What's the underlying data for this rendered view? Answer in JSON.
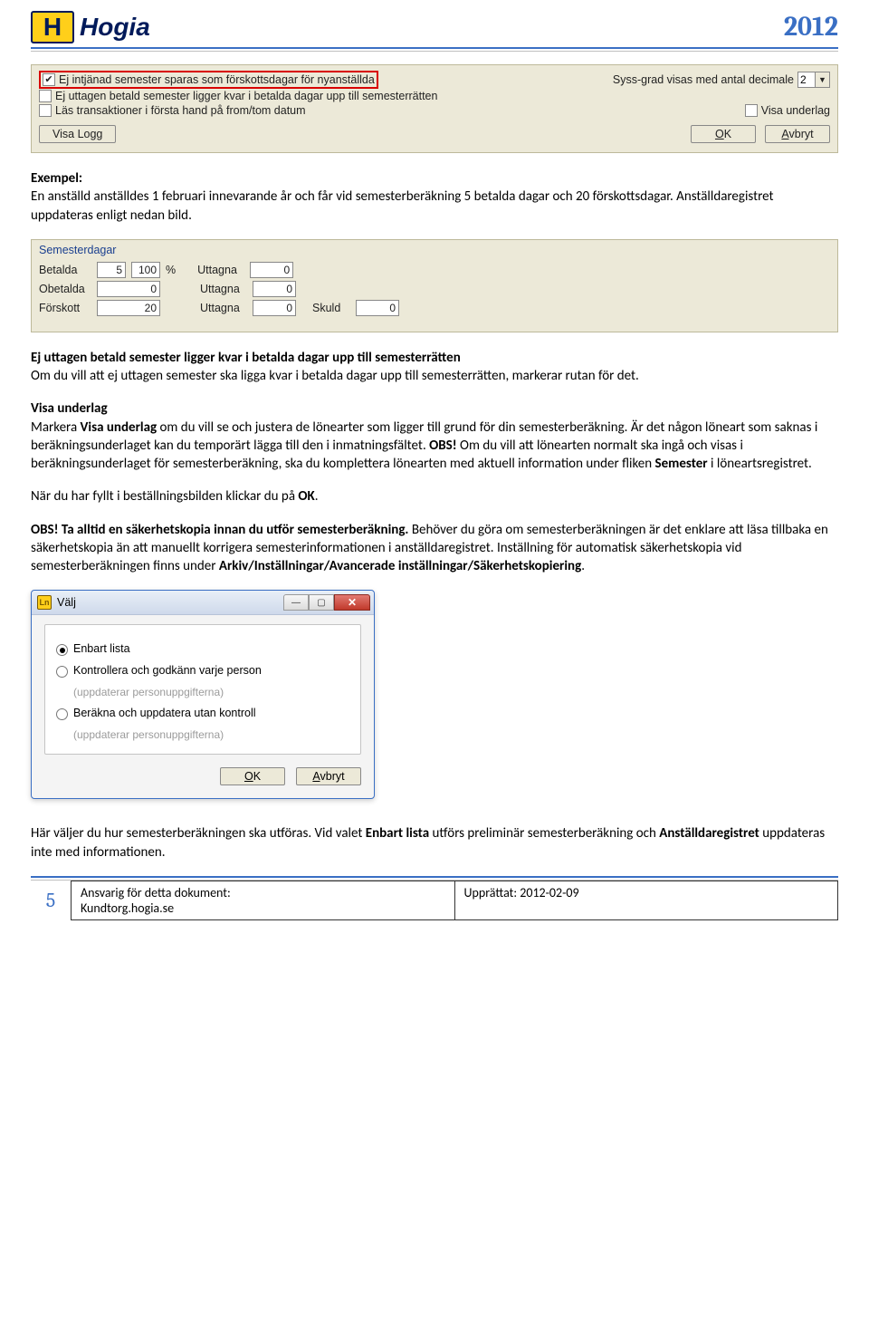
{
  "header": {
    "logo_letter": "H",
    "logo_text": "Hogia",
    "year": "2012"
  },
  "panel1": {
    "cb1": "Ej intjänad semester sparas som förskottsdagar för nyanställda",
    "cb2": "Ej uttagen betald semester ligger kvar i betalda dagar upp till semesterrätten",
    "cb3": "Läs transaktioner i första hand på from/tom datum",
    "syss_label": "Syss-grad visas med antal decimale",
    "syss_value": "2",
    "cb4": "Visa underlag",
    "btn_logg": "Visa Logg",
    "btn_ok_u": "O",
    "btn_ok_rest": "K",
    "btn_cancel_u": "A",
    "btn_cancel_rest": "vbryt"
  },
  "text1": {
    "ex_head": "Exempel:",
    "ex_body": "En anställd anställdes 1 februari innevarande år och får vid semesterberäkning 5 betalda dagar och 20 förskottsdagar. Anställdaregistret uppdateras enligt nedan bild."
  },
  "panel2": {
    "group_title": "Semesterdagar",
    "rows": [
      {
        "label": "Betalda",
        "v1": "5",
        "v2": "100",
        "pct": "%",
        "label2": "Uttagna",
        "v3": "0"
      },
      {
        "label": "Obetalda",
        "v1": "0",
        "label2": "Uttagna",
        "v3": "0"
      },
      {
        "label": "Förskott",
        "v1": "20",
        "label2": "Uttagna",
        "v3": "0",
        "label3": "Skuld",
        "v4": "0"
      }
    ]
  },
  "text2": {
    "h1": "Ej uttagen betald semester ligger kvar i betalda dagar upp till semesterrätten",
    "p1": "Om du vill att ej uttagen semester ska ligga kvar i betalda dagar upp till semesterrätten, markerar rutan för det.",
    "h2": "Visa underlag",
    "p2a": "Markera ",
    "p2b_bold": "Visa underlag",
    "p2c": " om du vill se och justera de lönearter som ligger till grund för din semesterberäkning. Är det någon löneart som saknas i beräkningsunderlaget kan du temporärt lägga till den i inmatningsfältet. ",
    "p2_obs": "OBS!",
    "p2d": " Om du vill att lönearten normalt ska ingå och visas i beräkningsunderlaget för semesterberäkning, ska du komplettera lönearten med aktuell information under fliken ",
    "p2e_bold": "Semester",
    "p2f": " i löneartsregistret.",
    "p3a": "När du har fyllt i beställningsbilden klickar du på ",
    "p3b_bold": "OK",
    "p3c": ".",
    "p4_obs": "OBS! Ta alltid en säkerhetskopia innan du utför semesterberäkning.",
    "p4a": " Behöver du göra om semesterberäkningen är det enklare att läsa tillbaka en säkerhetskopia än att manuellt korrigera semesterinformationen i anställdaregistret. Inställning för automatisk säkerhetskopia vid semesterberäkningen finns under ",
    "p4b_bold": "Arkiv/Inställningar/Avancerade inställningar/Säkerhetskopiering",
    "p4c": "."
  },
  "dialog": {
    "title": "Välj",
    "opt1": "Enbart lista",
    "opt2": "Kontrollera och godkänn varje person",
    "opt2_sub": "(uppdaterar personuppgifterna)",
    "opt3": "Beräkna och uppdatera utan kontroll",
    "opt3_sub": "(uppdaterar personuppgifterna)",
    "btn_ok_u": "O",
    "btn_ok_rest": "K",
    "btn_cancel_u": "A",
    "btn_cancel_rest": "vbryt"
  },
  "text3": {
    "p1a": "Här väljer du hur semesterberäkningen ska utföras. Vid valet ",
    "p1b_bold": "Enbart lista",
    "p1c": " utförs preliminär semesterberäkning och ",
    "p1d_bold": "Anställdaregistret",
    "p1e": " uppdateras inte med informationen."
  },
  "footer": {
    "page": "5",
    "left1": "Ansvarig för detta dokument:",
    "left2": "Kundtorg.hogia.se",
    "right": "Upprättat: 2012-02-09"
  }
}
